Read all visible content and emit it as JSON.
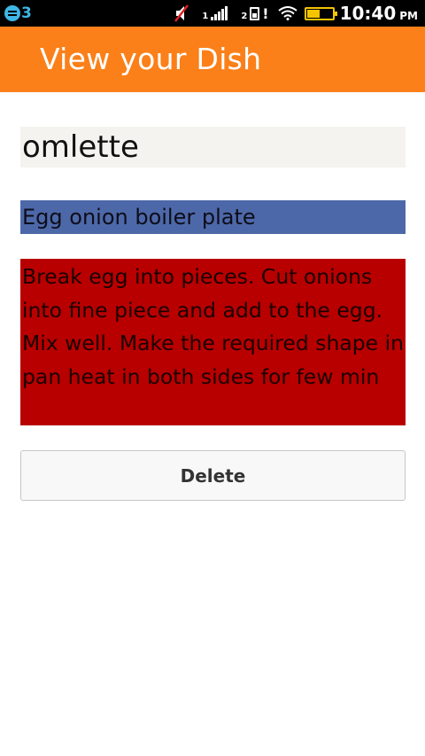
{
  "status_bar": {
    "notification_count": "3",
    "sim1_label": "1",
    "sim2_label": "2",
    "alert": "!",
    "time": "10:40",
    "ampm": "PM",
    "icons": [
      "notification-icon",
      "mute-icon",
      "signal-icon",
      "sim-icon",
      "wifi-icon",
      "battery-icon"
    ],
    "battery_color": "#f5c400",
    "notification_color": "#3fb6e6"
  },
  "header": {
    "title": "View your Dish",
    "background": "#fb8019"
  },
  "dish": {
    "name": "omlette",
    "ingredients": "Egg onion boiler plate",
    "instructions": "Break egg into pieces. Cut onions into fine piece and add to the egg. Mix well. Make the required shape in pan heat in both sides for few min",
    "name_background": "#f5f3ef",
    "ingredients_background": "#4d68a8",
    "instructions_background": "#b80000"
  },
  "actions": {
    "delete_label": "Delete"
  }
}
